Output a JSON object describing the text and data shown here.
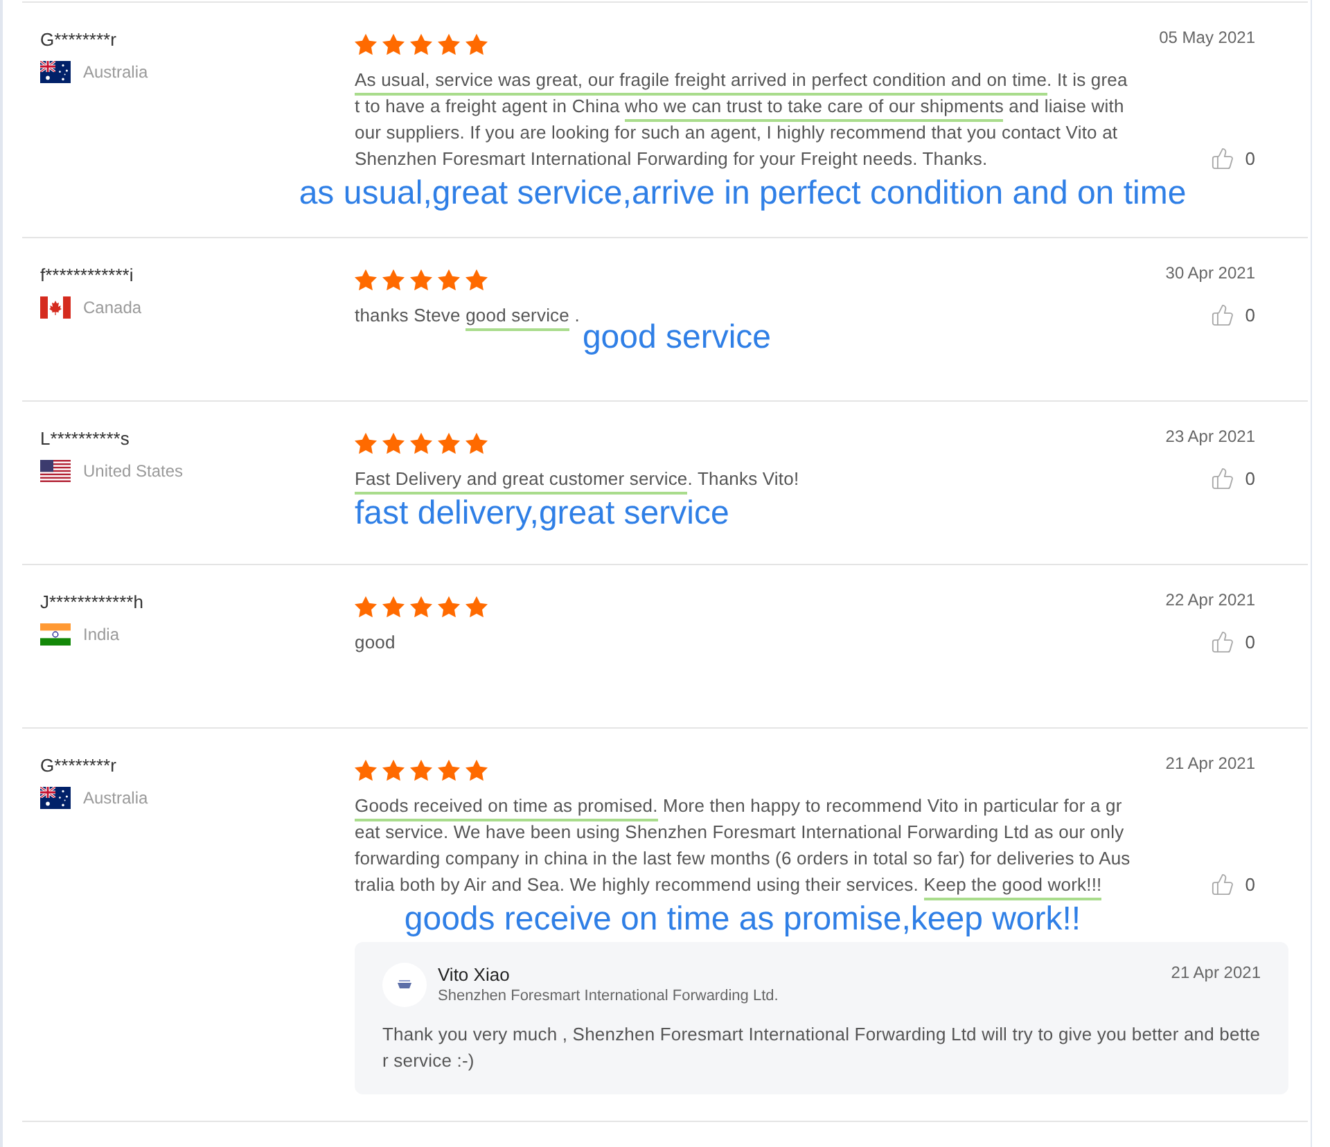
{
  "reviews": [
    {
      "author": {
        "name": "G********r",
        "country": "Australia",
        "flag": {
          "kind": "australia"
        }
      },
      "stars": 5,
      "date": "05 May 2021",
      "body": [
        {
          "text": "As usual, service was great, our fragile freight arrived in perfect condition and on time",
          "underlined": true
        },
        {
          "text": ". It is great to have a freight agent in China ",
          "underlined": false
        },
        {
          "text": "who we can trust to take care of our shipments",
          "underlined": true
        },
        {
          "text": " and liaise with our suppliers. If you are looking for such an agent, I highly recommend that you contact Vito at Shenzhen Foresmart International Forwarding for your Freight needs. Thanks.",
          "underlined": false
        }
      ],
      "likes": "0",
      "annotation": {
        "text": "as usual,great service,arrive in perfect condition and on time",
        "kind": "center"
      }
    },
    {
      "author": {
        "name": "f************i",
        "country": "Canada",
        "flag": {
          "kind": "canada"
        }
      },
      "stars": 5,
      "date": "30 Apr 2021",
      "body": [
        {
          "text": "thanks Steve ",
          "underlined": false
        },
        {
          "text": "good service",
          "underlined": true
        },
        {
          "text": " .",
          "underlined": false
        }
      ],
      "likes": "0",
      "annotation": {
        "text": "good service",
        "kind": "after"
      }
    },
    {
      "author": {
        "name": "L**********s",
        "country": "United States",
        "flag": {
          "kind": "usa"
        }
      },
      "stars": 5,
      "date": "23 Apr 2021",
      "body": [
        {
          "text": "Fast Delivery and great customer service",
          "underlined": true
        },
        {
          "text": ". Thanks Vito!",
          "underlined": false
        }
      ],
      "likes": "0",
      "annotation": {
        "text": "fast delivery,great service",
        "kind": "left"
      }
    },
    {
      "author": {
        "name": "J************h",
        "country": "India",
        "flag": {
          "kind": "india"
        }
      },
      "stars": 5,
      "date": "22 Apr 2021",
      "body": [
        {
          "text": "good",
          "underlined": false
        }
      ],
      "likes": "0"
    },
    {
      "author": {
        "name": "G********r",
        "country": "Australia",
        "flag": {
          "kind": "australia"
        }
      },
      "stars": 5,
      "date": "21 Apr 2021",
      "body": [
        {
          "text": "Goods received on time as promised.",
          "underlined": true
        },
        {
          "text": " More then happy to recommend Vito in particular for a great service. We have been using Shenzhen Foresmart International Forwarding Ltd as our only forwarding company in china in the last few months (6 orders in total so far) for deliveries to Australia both by Air and Sea. We highly recommend using their services. ",
          "underlined": false
        },
        {
          "text": "Keep the good work!!!",
          "underlined": true
        }
      ],
      "likes": "0",
      "annotation": {
        "text": "goods receive on time as promise,keep work!!",
        "kind": "center"
      },
      "reply": {
        "name": "Vito Xiao",
        "company": "Shenzhen Foresmart International Forwarding Ltd.",
        "date": "21 Apr 2021",
        "text": "Thank you very much , Shenzhen Foresmart International Forwarding Ltd will try to give you better and better service :-)"
      }
    }
  ]
}
